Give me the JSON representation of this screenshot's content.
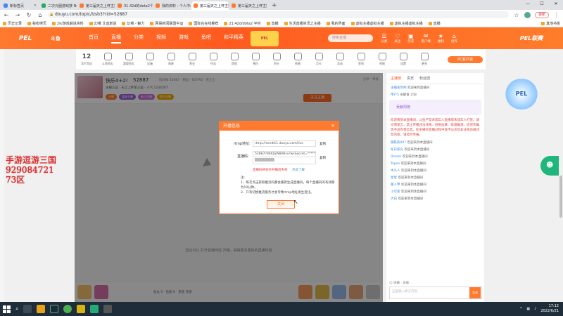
{
  "browser": {
    "tabs": [
      {
        "title": "新标签页",
        "color": "#4285f4",
        "active": false
      },
      {
        "title": "二次元圈游戏搜 NGA玩家社区",
        "color": "#2a6",
        "active": false
      },
      {
        "title": "第三届天之上杯主播联赛",
        "color": "#ff7a2e",
        "active": false
      },
      {
        "title": "31.42d的dota2个性",
        "color": "#ff7a2e",
        "active": false
      },
      {
        "title": "我的资料 - 个人中心 - 斗鱼",
        "color": "#ff7a2e",
        "active": false
      },
      {
        "title": "第三届天之上杯主播联赛",
        "color": "#ff7a2e",
        "active": true
      },
      {
        "title": "第三届天之上杯主播联赛",
        "color": "#ff7a2e",
        "active": false
      }
    ],
    "new_tab": "+",
    "url": "douyu.com/topic/lzsb3?rid=52887",
    "update_label": "更新",
    "bookmarks": [
      "历史记录",
      "秘密搜页",
      "2k/游戏解说资料",
      "幻维 艾迪斯说",
      "幻维 - 魅力",
      "网易新闻联盟牛运",
      "国际台在线推荐",
      "21.42d/dota2 平时",
      "直播",
      "生活直播资讯之主播",
      "我的界面",
      "虚拟主播虚拟主播",
      "虚拟主播虚拟主播",
      "直播"
    ],
    "bookmark_last": "其他书签"
  },
  "site": {
    "logo": "PEL",
    "logo2": "斗鱼",
    "nav": [
      "首页",
      "直播",
      "分类",
      "视频",
      "游戏",
      "鱼吧",
      "和平精英"
    ],
    "nav_active": 1,
    "banner": "PEL",
    "search_placeholder": "搜索直播",
    "header_icons": [
      {
        "icon": "☰",
        "label": "分类"
      },
      {
        "icon": "♡",
        "label": "关注"
      },
      {
        "icon": "▣",
        "label": "历史"
      },
      {
        "icon": "✉",
        "label": "客户端"
      },
      {
        "icon": "★",
        "label": "福利"
      },
      {
        "icon": "⌂",
        "label": "创作"
      }
    ],
    "pel_banner": "PEL联赛"
  },
  "strip": {
    "level": "12",
    "level_label": "我的等级",
    "items": [
      "斗鱼鱼丸",
      "超管鱼丸",
      "宝箱",
      "周星",
      "赏金",
      "任务",
      "提现",
      "预约",
      "积分",
      "鱼粮",
      "月卡",
      "活动",
      "签到",
      "举报",
      "设置",
      "更多"
    ],
    "fan_button": "PC客户端"
  },
  "room": {
    "title": "快乐4+2!",
    "room_id": "52887",
    "sub": "房间号 52887 · 粉丝 · DOTA2 · 天之上",
    "tags": "主播认证 · 天之上杯第三届 · 人气 1234567",
    "badges": [
      {
        "text": "主播",
        "color": "#ff7a2e"
      },
      {
        "text": "超级主播",
        "color": "#9b5fd8"
      },
      {
        "text": "新人主播",
        "color": "#c86dd7"
      },
      {
        "text": "签约主播",
        "color": "#f0a800"
      }
    ],
    "follow": "关注主播",
    "right_info": "分享 · 举报",
    "video_hint": "您还可以 打开直播伴侣 开播，获得更多更好的直播体验",
    "gift_info": "鱼丸 0 · 鱼翅 0 · 贵族 充值",
    "gifts": [
      "#f2c06a",
      "#d86da8",
      "#f29a5c",
      "#e0b84a",
      "#9ab8e8",
      "#e8a47a",
      "#c8c8c8"
    ]
  },
  "chat": {
    "tabs": [
      "主播榜",
      "贵宾",
      "粉丝团"
    ],
    "rank_label": "贡献周榜",
    "rows": [
      {
        "user": "主播爱你哟",
        "text": "欢迎来到直播间"
      },
      {
        "user": "用户5",
        "text": "贡献值 258"
      }
    ],
    "red_message": "欢迎来到本直播间，斗鱼严禁未成年人直播或未成年人打赏。请文明发言，禁止传播违法违规、低俗血暴、吸烟酗酒、造谣诈骗等不良有害信息。如主播在直播过程中宣传与涉及非法或违规违禁内容，请及时举报。",
    "messages": [
      {
        "user": "钢铁侠007",
        "text": "欢迎来到本直播间"
      },
      {
        "user": "冬日阳光",
        "text": "欢迎来到本直播间"
      },
      {
        "user": "Dream",
        "text": "欢迎来到本直播间"
      },
      {
        "user": "Tapoo",
        "text": "欢迎来到本直播间"
      },
      {
        "user": "木头人",
        "text": "欢迎来到本直播间"
      },
      {
        "user": "星星",
        "text": "欢迎来到本直播间"
      },
      {
        "user": "路人甲",
        "text": "欢迎来到本直播间"
      },
      {
        "user": "小可爱",
        "text": "欢迎来到本直播间"
      },
      {
        "user": "大白",
        "text": "欢迎来到本直播间"
      }
    ],
    "tools": "☺ 弹幕 · 屏蔽",
    "input_placeholder": "这里输入聊天内容",
    "send": "发送"
  },
  "overlay": {
    "line1": "手游逗游三国",
    "line2": "929084721",
    "line3": "73区"
  },
  "modal": {
    "title": "开播信息",
    "close": "×",
    "rtmp_label": "rtmp地址:",
    "rtmp_value": "rtmp://sendfc1.douyu.com/live",
    "key_label": "直播码:",
    "key_value": "52887rVNIQSW8Wlsv?wsSecret=***********",
    "key_blur": "████████",
    "copy": "复制",
    "copy2": "复制",
    "warning": "直播码将会在开播后失效",
    "reset_link": "点此了解",
    "notes_title": "注:",
    "note1": "1、每次点击获取推流码都会重新生成直播码，每个直播码的有效期为10分钟。",
    "note2": "2、只有切换推流服务才会导致rtmp地址发生变化。",
    "button": "关闭"
  },
  "taskbar": {
    "time": "17:12",
    "date": "2022/6/21"
  }
}
